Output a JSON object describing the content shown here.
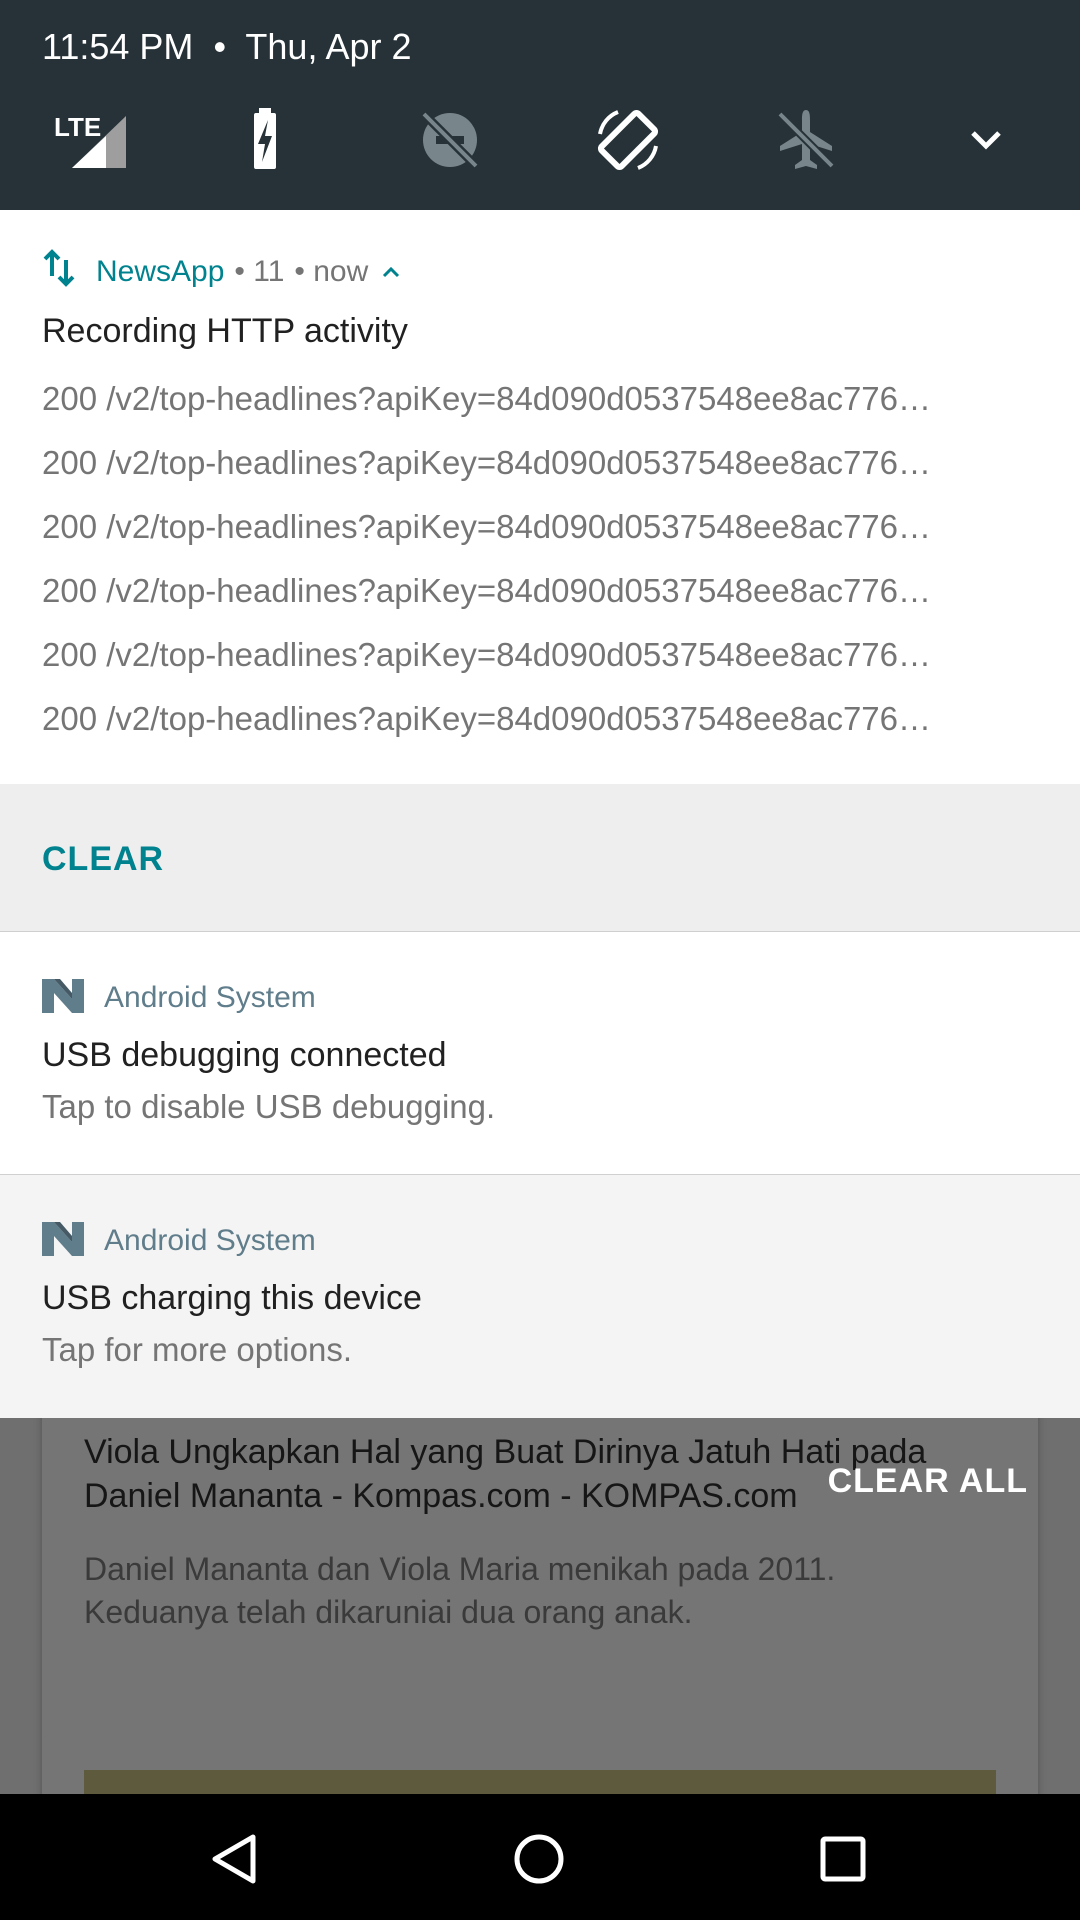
{
  "status": {
    "time": "11:54 PM",
    "separator": "•",
    "date": "Thu, Apr 2",
    "lte_label": "LTE"
  },
  "quick_settings_icons": [
    "signal-icon",
    "battery-charging-icon",
    "do-not-disturb-off-icon",
    "auto-rotate-icon",
    "airplane-mode-icon",
    "expand-icon"
  ],
  "http_notification": {
    "app_name": "NewsApp",
    "count": "• 11",
    "time": "• now",
    "title": "Recording HTTP activity",
    "lines": [
      "200 /v2/top-headlines?apiKey=84d090d0537548ee8ac776…",
      "200 /v2/top-headlines?apiKey=84d090d0537548ee8ac776…",
      "200 /v2/top-headlines?apiKey=84d090d0537548ee8ac776…",
      "200 /v2/top-headlines?apiKey=84d090d0537548ee8ac776…",
      "200 /v2/top-headlines?apiKey=84d090d0537548ee8ac776…",
      "200 /v2/top-headlines?apiKey=84d090d0537548ee8ac776…"
    ],
    "action_label": "CLEAR"
  },
  "usb_debug_notification": {
    "app_name": "Android System",
    "title": "USB debugging connected",
    "text": "Tap to disable USB debugging."
  },
  "usb_charge_notification": {
    "app_name": "Android System",
    "title": "USB charging this device",
    "text": "Tap for more options."
  },
  "clear_all_label": "CLEAR ALL",
  "background_article": {
    "title": "Viola Ungkapkan Hal yang Buat Dirinya Jatuh Hati pada Daniel Mananta - Kompas.com - KOMPAS.com",
    "description": "Daniel Mananta dan Viola Maria menikah pada 2011. Keduanya telah dikaruniai dua orang anak."
  },
  "colors": {
    "accent": "#00838f",
    "qs_background": "#263238",
    "system_app": "#607d8b"
  }
}
